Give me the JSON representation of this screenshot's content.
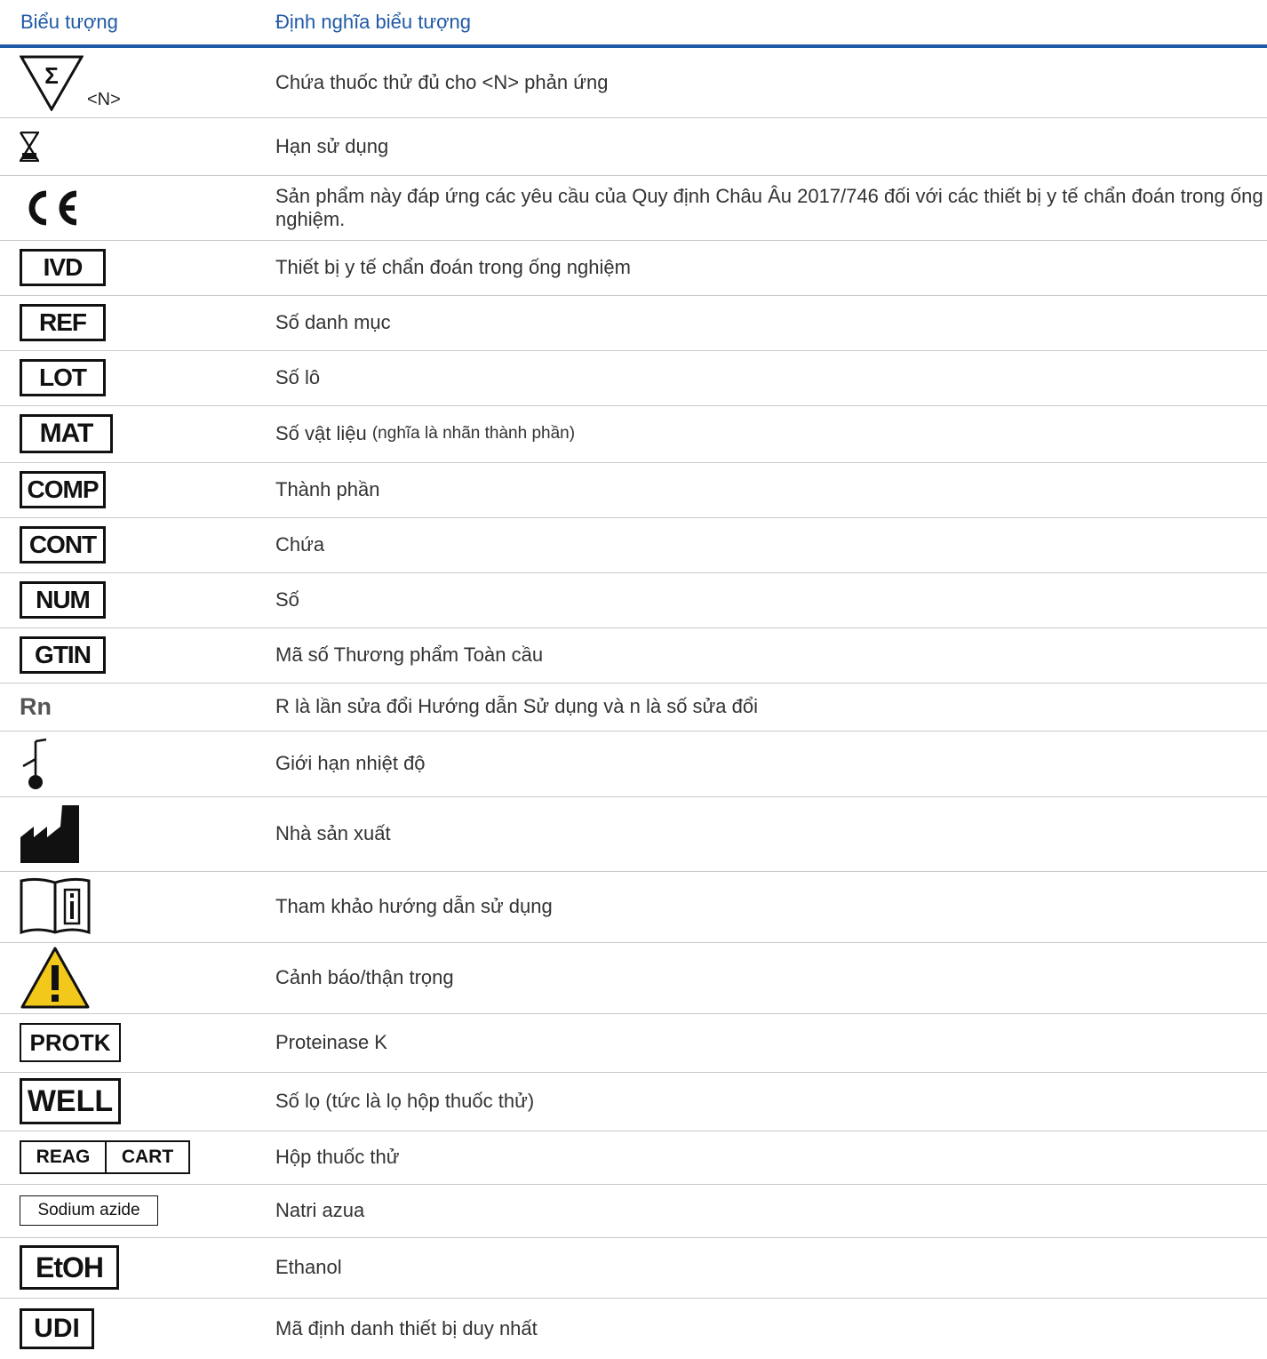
{
  "header": {
    "col_symbol": "Biểu tượng",
    "col_definition": "Định nghĩa biểu tượng"
  },
  "rows": {
    "sigma": {
      "symbol_note": "<N>",
      "definition": "Chứa thuốc thử đủ cho <N> phản ứng",
      "icon": "sigma-triangle-icon"
    },
    "expiry": {
      "definition": "Hạn sử dụng",
      "icon": "hourglass-icon"
    },
    "ce": {
      "definition": "Sản phẩm này đáp ứng các yêu cầu của Quy định Châu Âu 2017/746 đối với các thiết bị y tế chẩn đoán trong ống nghiệm.",
      "icon": "ce-mark-icon"
    },
    "ivd": {
      "label": "IVD",
      "definition": "Thiết bị y tế chẩn đoán trong ống nghiệm"
    },
    "ref": {
      "label": "REF",
      "definition": "Số danh mục"
    },
    "lot": {
      "label": "LOT",
      "definition": "Số lô"
    },
    "mat": {
      "label": "MAT",
      "definition": "Số vật liệu",
      "definition_note": "(nghĩa là nhãn thành phần)"
    },
    "comp": {
      "label": "COMP",
      "definition": "Thành phần"
    },
    "cont": {
      "label": "CONT",
      "definition": "Chứa"
    },
    "num": {
      "label": "NUM",
      "definition": "Số"
    },
    "gtin": {
      "label": "GTIN",
      "definition": "Mã số Thương phẩm Toàn cầu"
    },
    "rn": {
      "label": "Rn",
      "definition": "R là lần sửa đổi Hướng dẫn Sử dụng và n là số sửa đổi"
    },
    "temp": {
      "definition": "Giới hạn nhiệt độ",
      "icon": "thermometer-icon"
    },
    "manufacturer": {
      "definition": "Nhà sản xuất",
      "icon": "factory-icon"
    },
    "ifu": {
      "definition": "Tham khảo hướng dẫn sử dụng",
      "icon": "book-info-icon"
    },
    "warning": {
      "definition": "Cảnh báo/thận trọng",
      "icon": "warning-triangle-icon",
      "color": "#f2c81a"
    },
    "protk": {
      "label": "PROTK",
      "definition": "Proteinase K"
    },
    "well": {
      "label": "WELL",
      "definition": "Số lọ (tức là lọ hộp thuốc thử)"
    },
    "reagcart": {
      "label_left": "REAG",
      "label_right": "CART",
      "definition": "Hộp thuốc thử"
    },
    "azide": {
      "label": "Sodium azide",
      "definition": "Natri azua"
    },
    "etoh": {
      "label": "EtOH",
      "definition": "Ethanol"
    },
    "udi": {
      "label": "UDI",
      "definition": "Mã định danh thiết bị duy nhất"
    }
  },
  "colors": {
    "header_text": "#1f5aa6",
    "header_rule": "#1f5aa6",
    "row_rule": "#c8c8c8"
  }
}
